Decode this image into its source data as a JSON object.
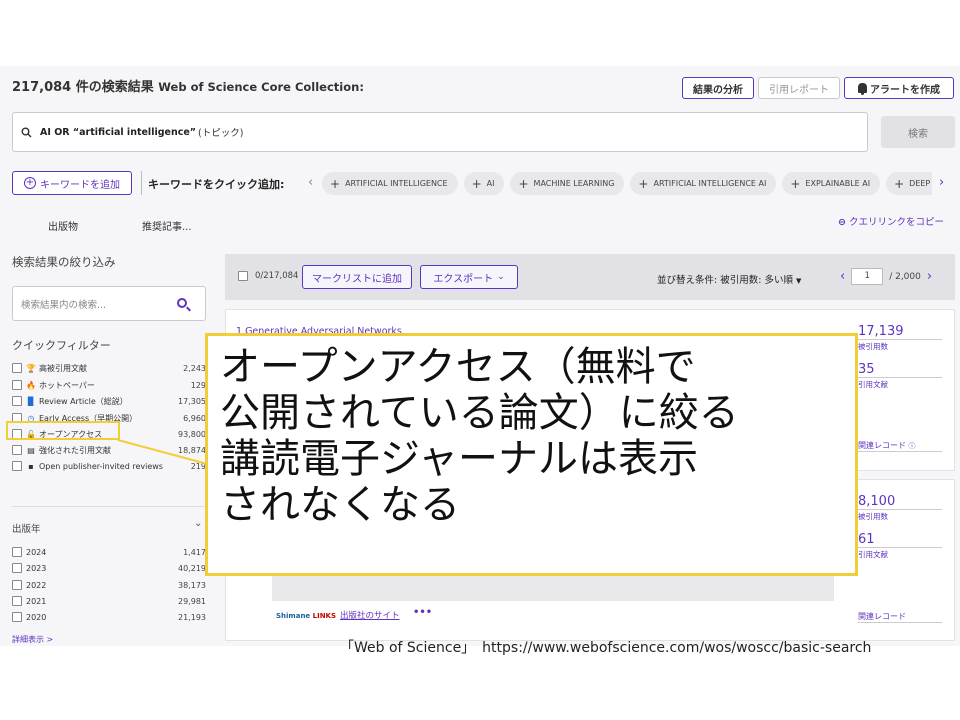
{
  "header": {
    "result_count": "217,084",
    "title_suffix": " 件の検索結果 ",
    "database": "Web of Science Core Collection:",
    "analyze_button": "結果の分析",
    "citation_report_button": "引用レポート",
    "alert_button": "アラートを作成"
  },
  "search": {
    "query": "AI OR “artificial intelligence”",
    "scope": "(トピック)",
    "button": "検索"
  },
  "keywords": {
    "add_button": "キーワードを追加",
    "quick_add_label": "キーワードをクイック追加:",
    "chips": [
      "ARTIFICIAL INTELLIGENCE",
      "AI",
      "MACHINE LEARNING",
      "ARTIFICIAL INTELLIGENCE AI",
      "EXPLAINABLE AI",
      "DEEP LEARNING"
    ]
  },
  "tabs": {
    "publications": "出版物",
    "recommended": "推奨記事...",
    "copy_query_link": "クエリリンクをコピー"
  },
  "sidebar": {
    "refine_heading": "検索結果の絞り込み",
    "search_placeholder": "検索結果内の検索...",
    "quick_filters_heading": "クイックフィルター",
    "filters": [
      {
        "icon": "trophy-icon",
        "glyph": "🏆",
        "color": "#c0392b",
        "label": "高被引用文献",
        "count": "2,243"
      },
      {
        "icon": "flame-icon",
        "glyph": "🔥",
        "color": "#e74c3c",
        "label": "ホットペーパー",
        "count": "129"
      },
      {
        "icon": "document-icon",
        "glyph": "▉",
        "color": "#1f6fd1",
        "label": "Review Article（総説）",
        "count": "17,305"
      },
      {
        "icon": "clock-icon",
        "glyph": "◷",
        "color": "#1f6fd1",
        "label": "Early Access（早期公開）",
        "count": "6,960"
      },
      {
        "icon": "lock-open-icon",
        "glyph": "🔓",
        "color": "#333333",
        "label": "オープンアクセス",
        "count": "93,800"
      },
      {
        "icon": "enriched-refs-icon",
        "glyph": "▤",
        "color": "#333333",
        "label": "強化された引用文献",
        "count": "18,874"
      },
      {
        "icon": "review-comment-icon",
        "glyph": "▪",
        "color": "#333333",
        "label": "Open publisher-invited reviews",
        "count": "219"
      }
    ],
    "year_heading": "出版年",
    "years": [
      {
        "year": "2024",
        "count": "1,417"
      },
      {
        "year": "2023",
        "count": "40,219"
      },
      {
        "year": "2022",
        "count": "38,173"
      },
      {
        "year": "2021",
        "count": "29,981"
      },
      {
        "year": "2020",
        "count": "21,193"
      }
    ],
    "more_link": "詳細表示 >"
  },
  "toolbar": {
    "marked": "0/217,084",
    "mark_list_button": "マークリストに追加",
    "export_button": "エクスポート",
    "sort_label": "並び替え条件: 被引用数: 多い順",
    "page_current": "1",
    "page_total": "/ 2,000"
  },
  "results": [
    {
      "title": "1    Generative Adversarial Networks",
      "times_cited": "17,139",
      "times_cited_label": "被引用数",
      "references": "35",
      "references_label": "引用文献",
      "related": "関連レコード"
    },
    {
      "times_cited": "8,100",
      "times_cited_label": "被引用数",
      "references": "61",
      "references_label": "引用文献",
      "related": "関連レコード",
      "full_text_brand_a": "Shimane",
      "full_text_brand_b": " LINKS",
      "publisher_site": "出版社のサイト",
      "more": "•••"
    }
  ],
  "callout": {
    "line1": "オープンアクセス（無料で",
    "line2": "公開されている論文）に絞る",
    "line3": "講読電子ジャーナルは表示",
    "line4": "されなくなる"
  },
  "source": "「Web of Science」　https://www.webofscience.com/wos/woscc/basic-search",
  "colors": {
    "accent": "#5e33bf",
    "highlight": "#f2cd3a"
  }
}
